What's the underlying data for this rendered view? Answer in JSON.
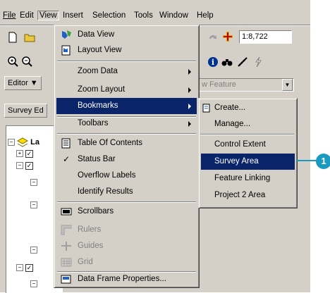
{
  "menubar": [
    "File",
    "Edit",
    "View",
    "Insert",
    "Selection",
    "Tools",
    "Window",
    "Help"
  ],
  "toolbar": {
    "scale": "1:8,722",
    "editor_label": "Editor ▼",
    "feature_field": "w Feature",
    "survey_label": "Survey Ed"
  },
  "toc": {
    "title_fragment": "La"
  },
  "view_menu": {
    "items": [
      {
        "label": "Data View",
        "icon": "data-view-icon"
      },
      {
        "label": "Layout View",
        "icon": "layout-view-icon"
      },
      {
        "label": "Zoom Data"
      },
      {
        "label": "Zoom Layout"
      },
      {
        "label": "Bookmarks",
        "state": "highlighted"
      },
      {
        "label": "Toolbars"
      },
      {
        "label": "Table Of Contents",
        "icon": "table-of-contents-icon"
      },
      {
        "label": "Status Bar",
        "checked": true
      },
      {
        "label": "Overflow Labels"
      },
      {
        "label": "Identify Results"
      },
      {
        "label": "Scrollbars",
        "icon": "scrollbars-icon"
      },
      {
        "label": "Rulers",
        "state": "disabled",
        "icon": "rulers-icon"
      },
      {
        "label": "Guides",
        "state": "disabled",
        "icon": "guides-icon"
      },
      {
        "label": "Grid",
        "state": "disabled",
        "icon": "grid-icon"
      },
      {
        "label": "Data Frame Properties...",
        "icon": "data-frame-properties-icon"
      }
    ]
  },
  "bookmarks_submenu": {
    "items": [
      {
        "label": "Create...",
        "icon": "create-bookmark-icon"
      },
      {
        "label": "Manage..."
      },
      {
        "label": "Control Extent"
      },
      {
        "label": "Survey Area",
        "state": "highlighted"
      },
      {
        "label": "Feature Linking"
      },
      {
        "label": "Project 2 Area"
      }
    ]
  },
  "callout": "1",
  "colors": {
    "highlight": "#0a246a",
    "callout": "#1a9abf",
    "chrome": "#d4d0c8"
  }
}
